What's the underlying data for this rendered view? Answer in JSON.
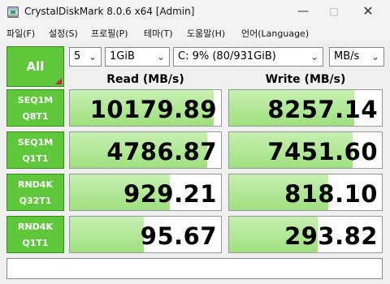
{
  "window": {
    "title": "CrystalDiskMark 8.0.6 x64 [Admin]"
  },
  "menu": [
    "파일(F)",
    "설정(S)",
    "프로필(P)",
    "테마(T)",
    "도움말(H)",
    "언어(Language)"
  ],
  "controls": {
    "all_label": "All",
    "count": "5",
    "size": "1GiB",
    "drive": "C: 9% (80/931GiB)",
    "unit": "MB/s"
  },
  "headers": {
    "read": "Read (MB/s)",
    "write": "Write (MB/s)"
  },
  "tests": [
    {
      "line1": "SEQ1M",
      "line2": "Q8T1",
      "read": "10179.89",
      "write": "8257.14",
      "read_fill": 0.95,
      "write_fill": 0.82
    },
    {
      "line1": "SEQ1M",
      "line2": "Q1T1",
      "read": "4786.87",
      "write": "7451.60",
      "read_fill": 0.91,
      "write_fill": 0.81
    },
    {
      "line1": "RND4K",
      "line2": "Q32T1",
      "read": "929.21",
      "write": "818.10",
      "read_fill": 0.66,
      "write_fill": 0.65
    },
    {
      "line1": "RND4K",
      "line2": "Q1T1",
      "read": "95.67",
      "write": "293.82",
      "read_fill": 0.49,
      "write_fill": 0.58
    }
  ],
  "status": "",
  "colors": {
    "accent": "#5ec83a",
    "bar": "#a8e48a"
  }
}
